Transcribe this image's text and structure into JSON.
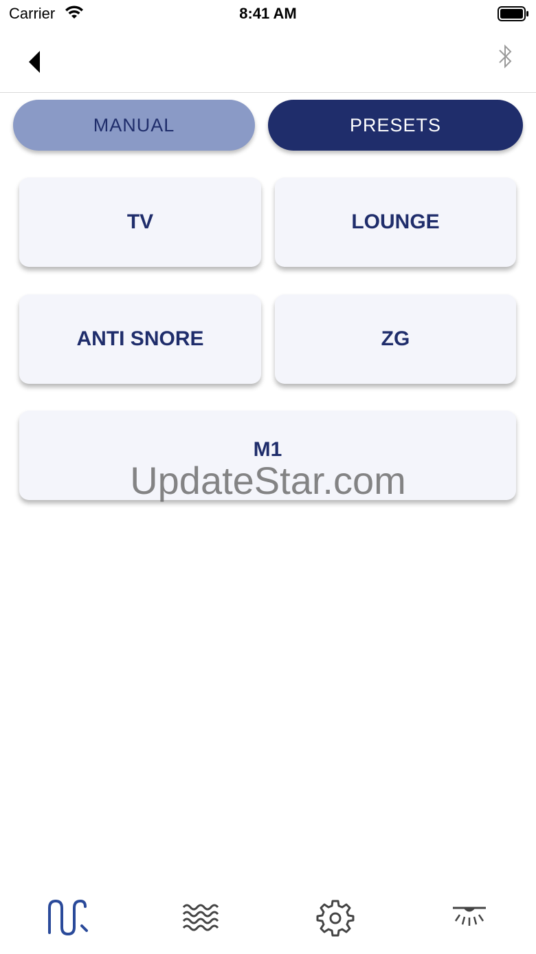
{
  "status_bar": {
    "carrier": "Carrier",
    "time": "8:41 AM"
  },
  "nav": {
    "back_icon": "back-triangle-icon",
    "right_icon": "bluetooth-icon"
  },
  "segments": {
    "manual": "MANUAL",
    "presets": "PRESETS",
    "selected": "PRESETS"
  },
  "presets": [
    {
      "label": "TV"
    },
    {
      "label": "LOUNGE"
    },
    {
      "label": "ANTI SNORE"
    },
    {
      "label": "ZG"
    },
    {
      "label": "M1"
    }
  ],
  "watermark": "UpdateStar.com",
  "tabs": [
    {
      "icon": "position-wave-icon",
      "active": true
    },
    {
      "icon": "massage-waves-icon",
      "active": false
    },
    {
      "icon": "gear-icon",
      "active": false
    },
    {
      "icon": "underbed-light-icon",
      "active": false
    }
  ],
  "colors": {
    "primary_navy": "#1f2d6b",
    "segment_inactive": "#8a9ac6",
    "card_bg": "#f4f5fb",
    "active_tab": "#2a4a9a",
    "inactive_tab": "#444444"
  }
}
